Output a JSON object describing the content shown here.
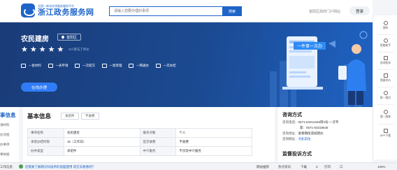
{
  "header": {
    "logo_subtitle": "全国一体化在线政务服务平台",
    "logo_title": "浙江政务服务网",
    "search_placeholder": "请输入您要办理的事项",
    "search_button": "搜索",
    "region_link": "富阳区政府门户网站",
    "login_button": "登录"
  },
  "hero": {
    "title": "农民建房",
    "region": "富阳区",
    "rating_stars": 5,
    "rating_text": "0人参与了评价",
    "features": [
      "一套材料",
      "一表申请",
      "一次提交",
      "一窗受理",
      "一网通办",
      "一次办结"
    ],
    "online_button": "在线办理",
    "banner_tag": "一件事一次办"
  },
  "left_nav": {
    "active": "事信息",
    "items": [
      "请材料",
      "办流程",
      "办事项",
      "事依据"
    ]
  },
  "basic_info": {
    "title": "基本信息",
    "tabs": [
      "承诺件",
      "不收费"
    ],
    "rows": [
      [
        "事项名称",
        "农民建房",
        "服务对象",
        "个人"
      ],
      [
        "承诺办结时限",
        "15（工作日）",
        "是否收费",
        "不收费"
      ],
      [
        "办件类型",
        "承诺件",
        "中介服务",
        "不涉及中介服务"
      ]
    ]
  },
  "consult": {
    "title": "咨询方式",
    "phone_label": "咨询电话：",
    "phone1": "0571-63312345转3号-一次专",
    "phone2": "家：0571-63318645",
    "address_label": "咨询地址：",
    "address": "富春镇街道城建办",
    "site_label": "咨询网址：",
    "site": "点此前往",
    "supervise_title": "监督投诉方式"
  },
  "right_rail": [
    "我的",
    "智能助手",
    "咨询投诉",
    "我要评价",
    "帮一我问",
    "我一我练",
    "APP下载"
  ],
  "statusbar": {
    "left_text": "工作信息",
    "tip": "您需要了解网页科技所的电脑使用 现在去看看吧？",
    "items": [
      "网站推荐",
      "热点资讯",
      "下载",
      "Z",
      "打印",
      "口",
      "100%"
    ]
  }
}
